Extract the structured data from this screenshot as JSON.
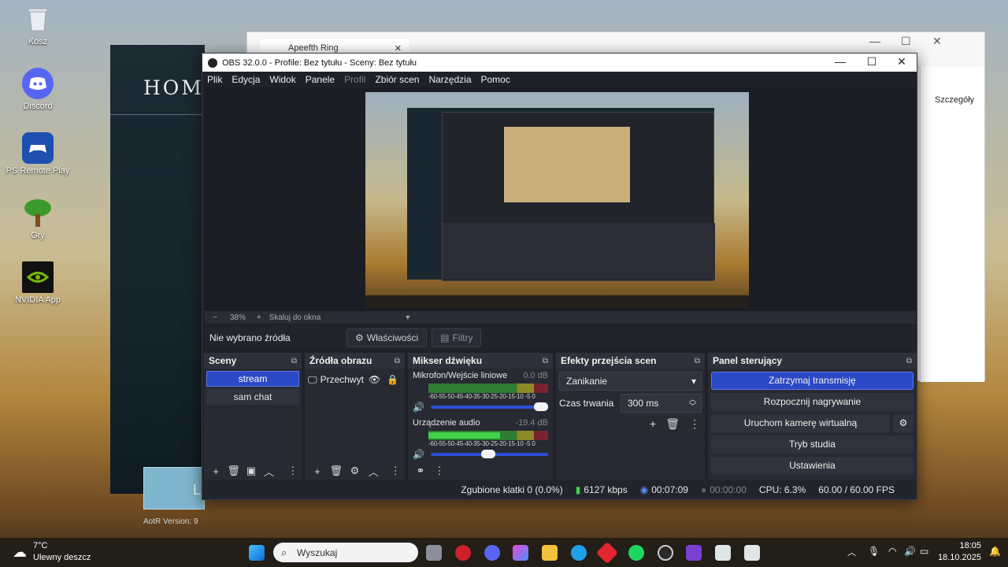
{
  "desktop": {
    "icons": [
      {
        "label": "Kosz"
      },
      {
        "label": "Discord"
      },
      {
        "label": "PS Remote Play"
      },
      {
        "label": "Gry"
      },
      {
        "label": "NVIDIA App"
      }
    ]
  },
  "launcher": {
    "title": "HOMI",
    "button_text": "L",
    "version": "AotR Version: 9"
  },
  "browser": {
    "tab_title": "Apeefth Ring",
    "details_label": "Szczegóły"
  },
  "obs": {
    "title": "OBS 32.0.0 - Profile: Bez tytułu - Sceny: Bez tytułu",
    "menu": [
      "Plik",
      "Edycja",
      "Widok",
      "Panele",
      "Profil",
      "Zbiór scen",
      "Narzędzia",
      "Pomoc"
    ],
    "zoom": {
      "minus": "−",
      "value": "38%",
      "plus": "+",
      "fit": "Skaluj do okna"
    },
    "source_bar": {
      "label": "Nie wybrano źródła",
      "properties": "Właściwości",
      "filters": "Filtry"
    },
    "scenes": {
      "header": "Sceny",
      "items": [
        "stream",
        "sam chat"
      ]
    },
    "sources": {
      "header": "Źródła obrazu",
      "items": [
        "Przechwyt"
      ]
    },
    "mixer": {
      "header": "Mikser dźwięku",
      "channels": [
        {
          "name": "Mikrofon/Wejście liniowe",
          "db": "0.0 dB",
          "level": 0.0,
          "volume": 1.0
        },
        {
          "name": "Urządzenie audio",
          "db": "-19.4 dB",
          "level": 0.6,
          "volume": 0.55
        }
      ],
      "scale": "-60-55-50-45-40-35-30-25-20-15-10 -5  0"
    },
    "transitions": {
      "header": "Efekty przejścia scen",
      "effect": "Zanikanie",
      "duration_label": "Czas trwania",
      "duration": "300 ms"
    },
    "controls": {
      "header": "Panel sterujący",
      "stop_stream": "Zatrzymaj transmisję",
      "start_recording": "Rozpocznij nagrywanie",
      "virtual_camera": "Uruchom kamerę wirtualną",
      "studio_mode": "Tryb studia",
      "settings": "Ustawienia"
    },
    "status": {
      "dropped": "Zgubione klatki 0 (0.0%)",
      "bitrate": "6127 kbps",
      "stream_time": "00:07:09",
      "rec_time": "00:00:00",
      "cpu": "CPU: 6.3%",
      "fps": "60.00 / 60.00 FPS"
    }
  },
  "taskbar": {
    "weather_temp": "7°C",
    "weather_desc": "Ulewny deszcz",
    "search_placeholder": "Wyszukaj",
    "time": "18:05",
    "date": "18.10.2025"
  },
  "colors": {
    "accent": "#2b49c5",
    "obs_bg": "#1f2129",
    "dock_bg": "#272a33"
  }
}
